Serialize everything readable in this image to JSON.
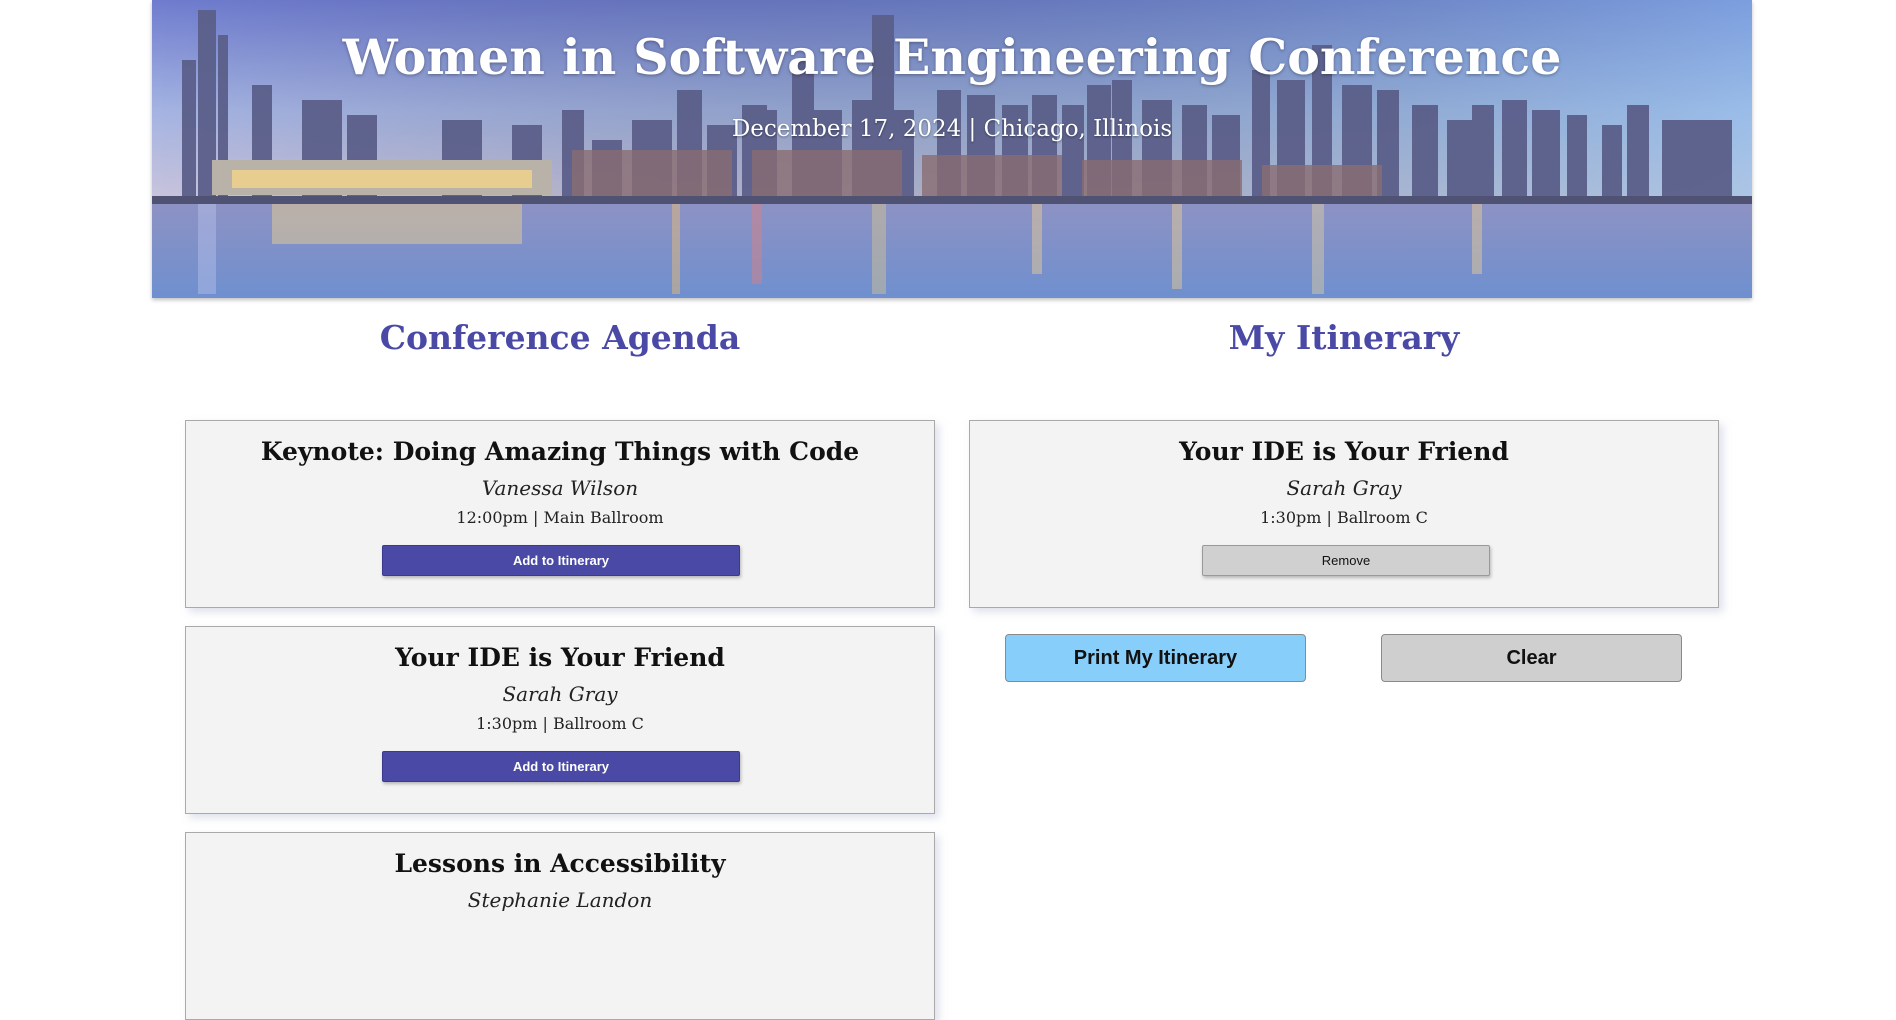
{
  "header": {
    "title": "Women in Software Engineering Conference",
    "subtitle": "December 17, 2024 | Chicago, Illinois"
  },
  "agenda": {
    "heading": "Conference Agenda",
    "sessions": [
      {
        "title": "Keynote: Doing Amazing Things with Code",
        "speaker": "Vanessa Wilson",
        "meta": "12:00pm | Main Ballroom",
        "button": "Add to Itinerary"
      },
      {
        "title": "Your IDE is Your Friend",
        "speaker": "Sarah Gray",
        "meta": "1:30pm | Ballroom C",
        "button": "Add to Itinerary"
      },
      {
        "title": "Lessons in Accessibility",
        "speaker": "Stephanie Landon",
        "meta": "",
        "button": ""
      }
    ]
  },
  "itinerary": {
    "heading": "My Itinerary",
    "sessions": [
      {
        "title": "Your IDE is Your Friend",
        "speaker": "Sarah Gray",
        "meta": "1:30pm | Ballroom C",
        "button": "Remove"
      }
    ],
    "print_label": "Print My Itinerary",
    "clear_label": "Clear"
  },
  "colors": {
    "accent": "#4a4aa6",
    "print_button": "#87cefa",
    "clear_button": "#cfcfcf",
    "card_bg": "#f3f3f3"
  }
}
